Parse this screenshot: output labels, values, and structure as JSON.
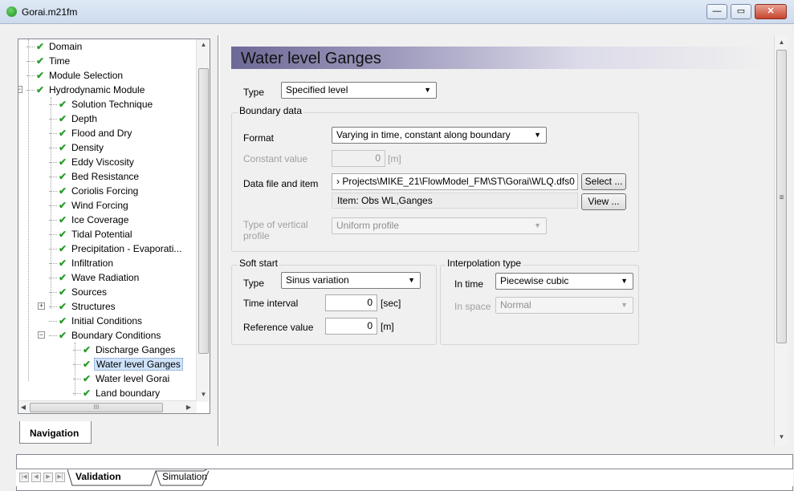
{
  "window": {
    "title": "Gorai.m21fm",
    "min_glyph": "—",
    "max_glyph": "▭",
    "close_glyph": "✕"
  },
  "tree": {
    "items": [
      {
        "label": "Domain"
      },
      {
        "label": "Time"
      },
      {
        "label": "Module Selection"
      },
      {
        "label": "Hydrodynamic Module"
      },
      {
        "label": "Solution Technique"
      },
      {
        "label": "Depth"
      },
      {
        "label": "Flood and Dry"
      },
      {
        "label": "Density"
      },
      {
        "label": "Eddy Viscosity"
      },
      {
        "label": "Bed Resistance"
      },
      {
        "label": "Coriolis Forcing"
      },
      {
        "label": "Wind Forcing"
      },
      {
        "label": "Ice Coverage"
      },
      {
        "label": "Tidal Potential"
      },
      {
        "label": "Precipitation - Evaporati..."
      },
      {
        "label": "Infiltration"
      },
      {
        "label": "Wave Radiation"
      },
      {
        "label": "Sources"
      },
      {
        "label": "Structures"
      },
      {
        "label": "Initial Conditions"
      },
      {
        "label": "Boundary Conditions"
      },
      {
        "label": "Discharge Ganges"
      },
      {
        "label": "Water level Ganges"
      },
      {
        "label": "Water level Gorai"
      },
      {
        "label": "Land boundary"
      }
    ],
    "selected": "Water level Ganges",
    "hscroll_grip": "III"
  },
  "nav_tab": "Navigation",
  "panel": {
    "title": "Water level Ganges",
    "type_label": "Type",
    "type_value": "Specified level",
    "boundary_group": "Boundary data",
    "format_label": "Format",
    "format_value": "Varying in time, constant along boundary",
    "constant_label": "Constant value",
    "constant_value": "0",
    "constant_unit": "[m]",
    "datafile_label": "Data file and item",
    "datafile_value": "› Projects\\MIKE_21\\FlowModel_FM\\ST\\Gorai\\WLQ.dfs0",
    "select_button": "Select ...",
    "item_value": "Item:  Obs WL,Ganges",
    "view_button": "View ...",
    "vertical_label": "Type of vertical profile",
    "vertical_value": "Uniform profile",
    "softstart_group": "Soft start",
    "ss_type_label": "Type",
    "ss_type_value": "Sinus variation",
    "time_interval_label": "Time interval",
    "time_interval_value": "0",
    "time_interval_unit": "[sec]",
    "reference_label": "Reference value",
    "reference_value": "0",
    "reference_unit": "[m]",
    "interp_group": "Interpolation type",
    "in_time_label": "In time",
    "in_time_value": "Piecewise cubic",
    "in_space_label": "In space",
    "in_space_value": "Normal"
  },
  "bottom_tabs": {
    "tabs": [
      "Validation",
      "Simulation"
    ],
    "active": "Validation"
  }
}
